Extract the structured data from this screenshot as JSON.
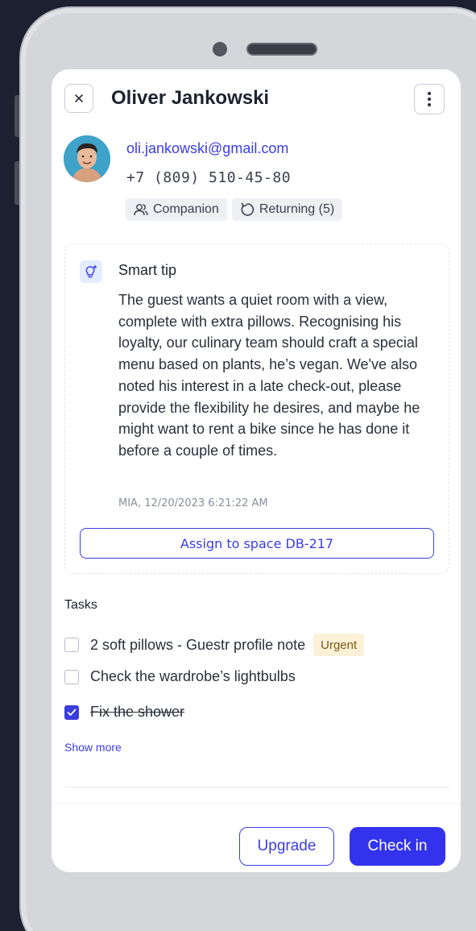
{
  "header": {
    "guest_name": "Oliver Jankowski"
  },
  "guest": {
    "email": "oli.jankowski@gmail.com",
    "phone": "+7 (809) 510-45-80",
    "tags": [
      {
        "label": "Companion",
        "icon": "user-group-icon"
      },
      {
        "label": "Returning (5)",
        "icon": "returning-icon"
      }
    ]
  },
  "smart_tip": {
    "title": "Smart tip",
    "body": "The guest wants a quiet room with a view, complete with extra pillows. Recognising his loyalty, our culinary team should craft a special menu based on plants, he’s vegan. We've also noted his interest in a late check-out, please provide the flexibility he desires, and maybe he might want to rent a bike since he has done it before a couple of times.",
    "meta": "MIA, 12/20/2023 6:21:22 AM",
    "assign_label": "Assign to space DB-217"
  },
  "tasks": {
    "heading": "Tasks",
    "items": [
      {
        "label": "2 soft pillows - Guestr profile note",
        "checked": false,
        "badge": "Urgent"
      },
      {
        "label": "Check the wardrobe’s lightbulbs",
        "checked": false
      },
      {
        "label": "Fix the shower",
        "checked": true
      }
    ],
    "show_more": "Show more"
  },
  "footer": {
    "upgrade_label": "Upgrade",
    "checkin_label": "Check in"
  },
  "colors": {
    "accent": "#3a3ee0",
    "primary_button": "#3333ee",
    "urgent_bg": "#fdf1d8",
    "background": "#1c2030"
  }
}
